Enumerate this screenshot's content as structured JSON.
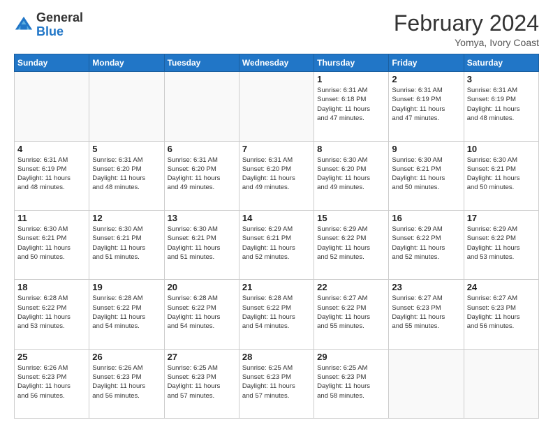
{
  "header": {
    "logo_general": "General",
    "logo_blue": "Blue",
    "month_year": "February 2024",
    "location": "Yomya, Ivory Coast"
  },
  "days_of_week": [
    "Sunday",
    "Monday",
    "Tuesday",
    "Wednesday",
    "Thursday",
    "Friday",
    "Saturday"
  ],
  "weeks": [
    [
      {
        "day": "",
        "info": ""
      },
      {
        "day": "",
        "info": ""
      },
      {
        "day": "",
        "info": ""
      },
      {
        "day": "",
        "info": ""
      },
      {
        "day": "1",
        "info": "Sunrise: 6:31 AM\nSunset: 6:18 PM\nDaylight: 11 hours\nand 47 minutes."
      },
      {
        "day": "2",
        "info": "Sunrise: 6:31 AM\nSunset: 6:19 PM\nDaylight: 11 hours\nand 47 minutes."
      },
      {
        "day": "3",
        "info": "Sunrise: 6:31 AM\nSunset: 6:19 PM\nDaylight: 11 hours\nand 48 minutes."
      }
    ],
    [
      {
        "day": "4",
        "info": "Sunrise: 6:31 AM\nSunset: 6:19 PM\nDaylight: 11 hours\nand 48 minutes."
      },
      {
        "day": "5",
        "info": "Sunrise: 6:31 AM\nSunset: 6:20 PM\nDaylight: 11 hours\nand 48 minutes."
      },
      {
        "day": "6",
        "info": "Sunrise: 6:31 AM\nSunset: 6:20 PM\nDaylight: 11 hours\nand 49 minutes."
      },
      {
        "day": "7",
        "info": "Sunrise: 6:31 AM\nSunset: 6:20 PM\nDaylight: 11 hours\nand 49 minutes."
      },
      {
        "day": "8",
        "info": "Sunrise: 6:30 AM\nSunset: 6:20 PM\nDaylight: 11 hours\nand 49 minutes."
      },
      {
        "day": "9",
        "info": "Sunrise: 6:30 AM\nSunset: 6:21 PM\nDaylight: 11 hours\nand 50 minutes."
      },
      {
        "day": "10",
        "info": "Sunrise: 6:30 AM\nSunset: 6:21 PM\nDaylight: 11 hours\nand 50 minutes."
      }
    ],
    [
      {
        "day": "11",
        "info": "Sunrise: 6:30 AM\nSunset: 6:21 PM\nDaylight: 11 hours\nand 50 minutes."
      },
      {
        "day": "12",
        "info": "Sunrise: 6:30 AM\nSunset: 6:21 PM\nDaylight: 11 hours\nand 51 minutes."
      },
      {
        "day": "13",
        "info": "Sunrise: 6:30 AM\nSunset: 6:21 PM\nDaylight: 11 hours\nand 51 minutes."
      },
      {
        "day": "14",
        "info": "Sunrise: 6:29 AM\nSunset: 6:21 PM\nDaylight: 11 hours\nand 52 minutes."
      },
      {
        "day": "15",
        "info": "Sunrise: 6:29 AM\nSunset: 6:22 PM\nDaylight: 11 hours\nand 52 minutes."
      },
      {
        "day": "16",
        "info": "Sunrise: 6:29 AM\nSunset: 6:22 PM\nDaylight: 11 hours\nand 52 minutes."
      },
      {
        "day": "17",
        "info": "Sunrise: 6:29 AM\nSunset: 6:22 PM\nDaylight: 11 hours\nand 53 minutes."
      }
    ],
    [
      {
        "day": "18",
        "info": "Sunrise: 6:28 AM\nSunset: 6:22 PM\nDaylight: 11 hours\nand 53 minutes."
      },
      {
        "day": "19",
        "info": "Sunrise: 6:28 AM\nSunset: 6:22 PM\nDaylight: 11 hours\nand 54 minutes."
      },
      {
        "day": "20",
        "info": "Sunrise: 6:28 AM\nSunset: 6:22 PM\nDaylight: 11 hours\nand 54 minutes."
      },
      {
        "day": "21",
        "info": "Sunrise: 6:28 AM\nSunset: 6:22 PM\nDaylight: 11 hours\nand 54 minutes."
      },
      {
        "day": "22",
        "info": "Sunrise: 6:27 AM\nSunset: 6:22 PM\nDaylight: 11 hours\nand 55 minutes."
      },
      {
        "day": "23",
        "info": "Sunrise: 6:27 AM\nSunset: 6:23 PM\nDaylight: 11 hours\nand 55 minutes."
      },
      {
        "day": "24",
        "info": "Sunrise: 6:27 AM\nSunset: 6:23 PM\nDaylight: 11 hours\nand 56 minutes."
      }
    ],
    [
      {
        "day": "25",
        "info": "Sunrise: 6:26 AM\nSunset: 6:23 PM\nDaylight: 11 hours\nand 56 minutes."
      },
      {
        "day": "26",
        "info": "Sunrise: 6:26 AM\nSunset: 6:23 PM\nDaylight: 11 hours\nand 56 minutes."
      },
      {
        "day": "27",
        "info": "Sunrise: 6:25 AM\nSunset: 6:23 PM\nDaylight: 11 hours\nand 57 minutes."
      },
      {
        "day": "28",
        "info": "Sunrise: 6:25 AM\nSunset: 6:23 PM\nDaylight: 11 hours\nand 57 minutes."
      },
      {
        "day": "29",
        "info": "Sunrise: 6:25 AM\nSunset: 6:23 PM\nDaylight: 11 hours\nand 58 minutes."
      },
      {
        "day": "",
        "info": ""
      },
      {
        "day": "",
        "info": ""
      }
    ]
  ]
}
